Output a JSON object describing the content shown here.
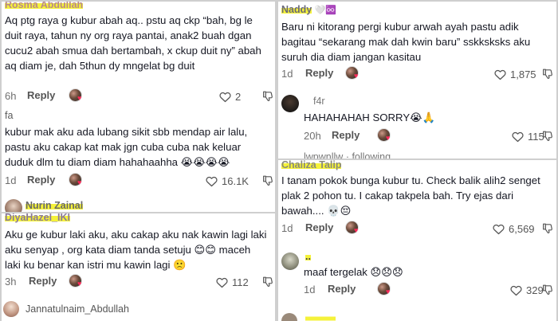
{
  "panels": {
    "top_left": {
      "comments": [
        {
          "username": "Rosma Abdullah",
          "text": "Aq ptg raya g kubur abah aq.. pstu aq ckp “bah, bg le duit raya, tahun ny org raya pantai, anak2 buah dgan cucu2 abah smua dah bertambah, x ckup duit ny” abah aq diam je, dah 5thun dy mngelat bg duit",
          "time": "6h",
          "reply": "Reply",
          "likes": "2"
        },
        {
          "username": "fa",
          "text": "kubur mak aku ada lubang sikit sbb mendap air lalu, pastu aku cakap kat mak jgn cuba cuba nak keluar duduk dlm tu diam diam hahahaahha 😭😭😭😭",
          "time": "1d",
          "reply": "Reply",
          "likes": "16.1K"
        },
        {
          "username": "Nurin Zainal"
        }
      ]
    },
    "bottom_left": {
      "comments": [
        {
          "username": "DiyaHazel_IKl",
          "text": "Aku ge kubur laki aku, aku cakap aku nak kawin lagi laki aku senyap , org kata diam tanda setuju 😊😊 maceh laki ku benar kan istri mu kawin lagi 🙁",
          "time": "3h",
          "reply": "Reply",
          "likes": "112"
        },
        {
          "username": "Jannatulnaim_Abdullah"
        }
      ]
    },
    "top_right": {
      "comments": [
        {
          "username": "Naddy",
          "username_suffix": "🤍♾️",
          "text": "Baru ni kitorang pergi kubur arwah ayah pastu adik bagitau “sekarang mak dah kwin baru” sskksksks aku suruh dia diam jangan kasitau",
          "time": "1d",
          "reply": "Reply",
          "likes": "1,875"
        },
        {
          "username": "f4r",
          "text": "HAHAHAHAH SORRY😭🙏",
          "time": "20h",
          "reply": "Reply",
          "likes": "115"
        },
        {
          "username": "lwpwnllw",
          "following": "· following"
        }
      ]
    },
    "bottom_right": {
      "comments": [
        {
          "username": "Chaliza Talip",
          "text": "I tanam pokok bunga kubur tu. Check balik alih2 senget plak 2 pohon tu. I cakap takpela bah. Try ejas dari bawah.... 💀😔",
          "time": "1d",
          "reply": "Reply",
          "likes": "6,569"
        },
        {
          "username": "..",
          "text": "maaf tergelak 😞😞😞",
          "time": "1d",
          "reply": "Reply",
          "likes": "329"
        }
      ]
    }
  },
  "colors": {
    "highlight": "#f5f23a",
    "creator_heart": "#ff2a5a",
    "text": "#161823",
    "meta": "#6f6f6f"
  },
  "icons": {
    "like": "heart-outline-icon",
    "dislike": "thumbs-down-icon",
    "creator_liked": "creator-avatar-icon"
  }
}
